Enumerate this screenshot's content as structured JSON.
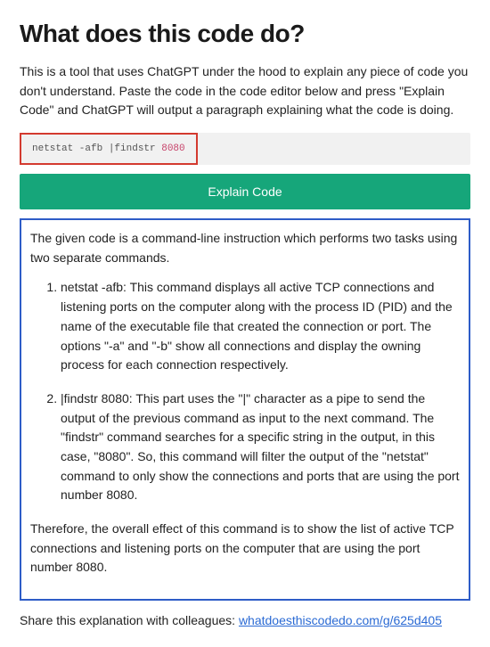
{
  "header": {
    "title": "What does this code do?"
  },
  "intro": "This is a tool that uses ChatGPT under the hood to explain any piece of code you don't understand. Paste the code in the code editor below and press \"Explain Code\" and ChatGPT will output a paragraph explaining what the code is doing.",
  "code": {
    "prefix": "netstat -afb |findstr ",
    "port": "8080"
  },
  "button": {
    "label": "Explain Code"
  },
  "explanation": {
    "lead": "The given code is a command-line instruction which performs two tasks using two separate commands.",
    "items": [
      "netstat -afb: This command displays all active TCP connections and listening ports on the computer along with the process ID (PID) and the name of the executable file that created the connection or port. The options \"-a\" and \"-b\" show all connections and display the owning process for each connection respectively.",
      "|findstr 8080: This part uses the \"|\" character as a pipe to send the output of the previous command as input to the next command. The \"findstr\" command searches for a specific string in the output, in this case, \"8080\". So, this command will filter the output of the \"netstat\" command to only show the connections and ports that are using the port number 8080."
    ],
    "conclusion": "Therefore, the overall effect of this command is to show the list of active TCP connections and listening ports on the computer that are using the port number 8080."
  },
  "share": {
    "label": "Share this explanation with colleagues: ",
    "link_text": "whatdoesthiscodedo.com/g/625d405"
  }
}
